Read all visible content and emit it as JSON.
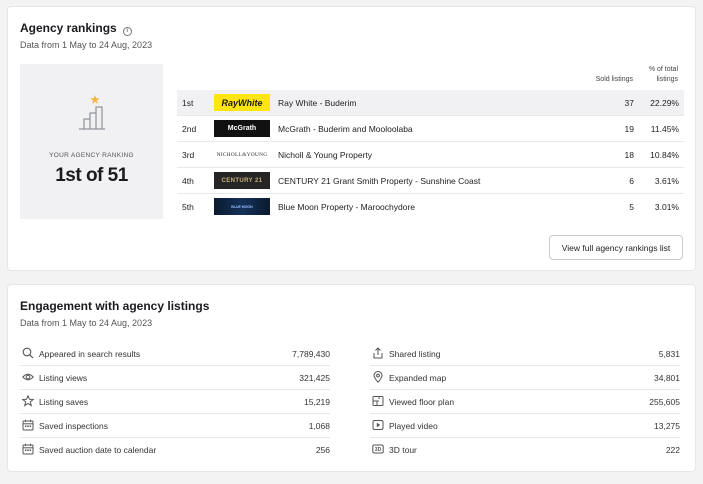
{
  "rankings": {
    "title": "Agency rankings",
    "subtitle": "Data from 1 May to 24 Aug, 2023",
    "your_ranking_caption": "YOUR AGENCY RANKING",
    "your_ranking_value": "1st of 51",
    "col_sold": "Sold listings",
    "col_pct_line1": "% of total",
    "col_pct_line2": "listings",
    "rows": [
      {
        "rank": "1st",
        "logo": "RayWhite",
        "name": "Ray White - Buderim",
        "sold": "37",
        "pct": "22.29%"
      },
      {
        "rank": "2nd",
        "logo": "McGrath",
        "name": "McGrath - Buderim and Mooloolaba",
        "sold": "19",
        "pct": "11.45%"
      },
      {
        "rank": "3rd",
        "logo": "NICHOLL&YOUNG",
        "name": "Nicholl & Young Property",
        "sold": "18",
        "pct": "10.84%"
      },
      {
        "rank": "4th",
        "logo": "CENTURY 21",
        "name": "CENTURY 21 Grant Smith Property - Sunshine Coast",
        "sold": "6",
        "pct": "3.61%"
      },
      {
        "rank": "5th",
        "logo": "BLUE MOON",
        "name": "Blue Moon Property - Maroochydore",
        "sold": "5",
        "pct": "3.01%"
      }
    ],
    "view_full_button": "View full agency rankings list"
  },
  "engagement": {
    "title": "Engagement with agency listings",
    "subtitle": "Data from 1 May to 24 Aug, 2023",
    "left": [
      {
        "icon": "search-icon",
        "label": "Appeared in search results",
        "value": "7,789,430"
      },
      {
        "icon": "eye-icon",
        "label": "Listing views",
        "value": "321,425"
      },
      {
        "icon": "star-icon",
        "label": "Listing saves",
        "value": "15,219"
      },
      {
        "icon": "calendar-icon",
        "label": "Saved inspections",
        "value": "1,068"
      },
      {
        "icon": "calendar-icon",
        "label": "Saved auction date to calendar",
        "value": "256"
      }
    ],
    "right": [
      {
        "icon": "share-icon",
        "label": "Shared listing",
        "value": "5,831"
      },
      {
        "icon": "map-pin-icon",
        "label": "Expanded map",
        "value": "34,801"
      },
      {
        "icon": "floor-plan-icon",
        "label": "Viewed floor plan",
        "value": "255,605"
      },
      {
        "icon": "play-icon",
        "label": "Played video",
        "value": "13,275"
      },
      {
        "icon": "3d-tour-icon",
        "label": "3D tour",
        "value": "222"
      }
    ]
  },
  "colors": {
    "raywhite_bg": "#ffe512",
    "mcgrath_bg": "#111111",
    "century21_bg": "#252526",
    "bluemoon_bg": "#0b1a2e",
    "highlight_row": "#f1f1f3",
    "star": "#f3b53d"
  }
}
